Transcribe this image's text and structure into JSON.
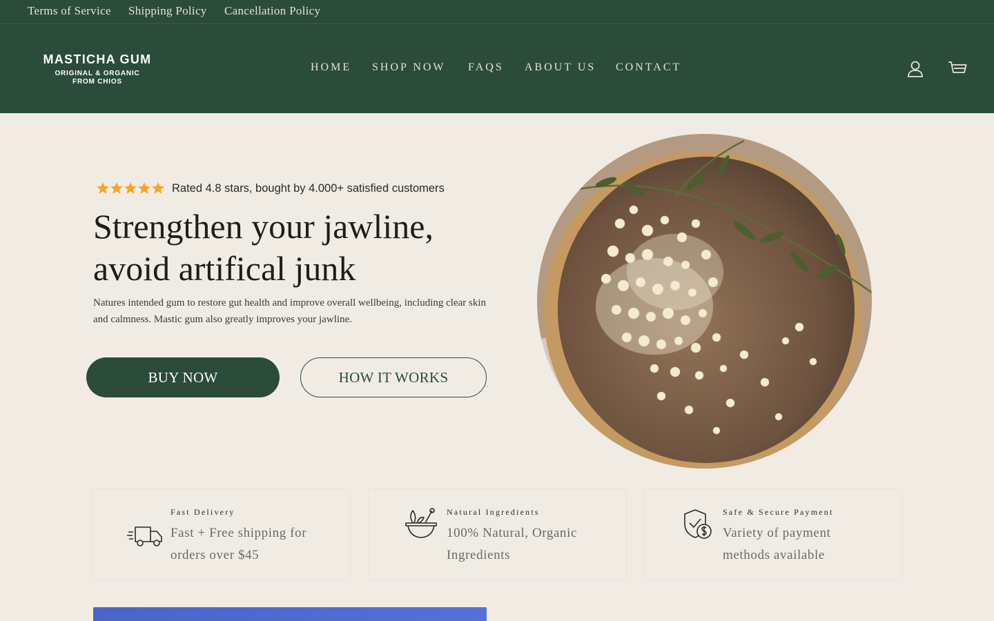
{
  "utility_bar": {
    "links": [
      "Terms of Service",
      "Shipping Policy",
      "Cancellation Policy"
    ]
  },
  "header": {
    "logo": {
      "main": "MASTICHA GUM",
      "line1": "ORIGINAL & ORGANIC",
      "line2": "FROM CHIOS"
    },
    "nav": [
      "HOME",
      "SHOP NOW",
      "FAQS",
      "ABOUT US",
      "CONTACT"
    ],
    "icons": [
      "user-icon",
      "cart-icon"
    ]
  },
  "hero": {
    "stars_rating": 5,
    "rating_text": "Rated 4.8 stars, bought by 4.000+ satisfied customers",
    "title_line1": "Strengthen your jawline,",
    "title_line2": "avoid artifical junk",
    "description": "Natures intended gum to restore gut health and improve overall wellbeing, including clear skin and calmness. Mastic gum also greatly improves your jawline.",
    "buy_label": "BUY NOW",
    "how_label": "HOW IT WORKS"
  },
  "features": [
    {
      "icon": "delivery-truck-icon",
      "title": "Fast Delivery",
      "desc": "Fast + Free shipping for orders over $45"
    },
    {
      "icon": "mortar-bowl-icon",
      "title": "Natural Ingredients",
      "desc": "100% Natural, Organic Ingredients"
    },
    {
      "icon": "secure-payment-icon",
      "title": "Safe & Secure Payment",
      "desc": "Variety of payment methods available"
    }
  ],
  "colors": {
    "brand_green": "#2b4c3b",
    "page_bg": "#f0ece4",
    "star_gold": "#f5a623"
  }
}
